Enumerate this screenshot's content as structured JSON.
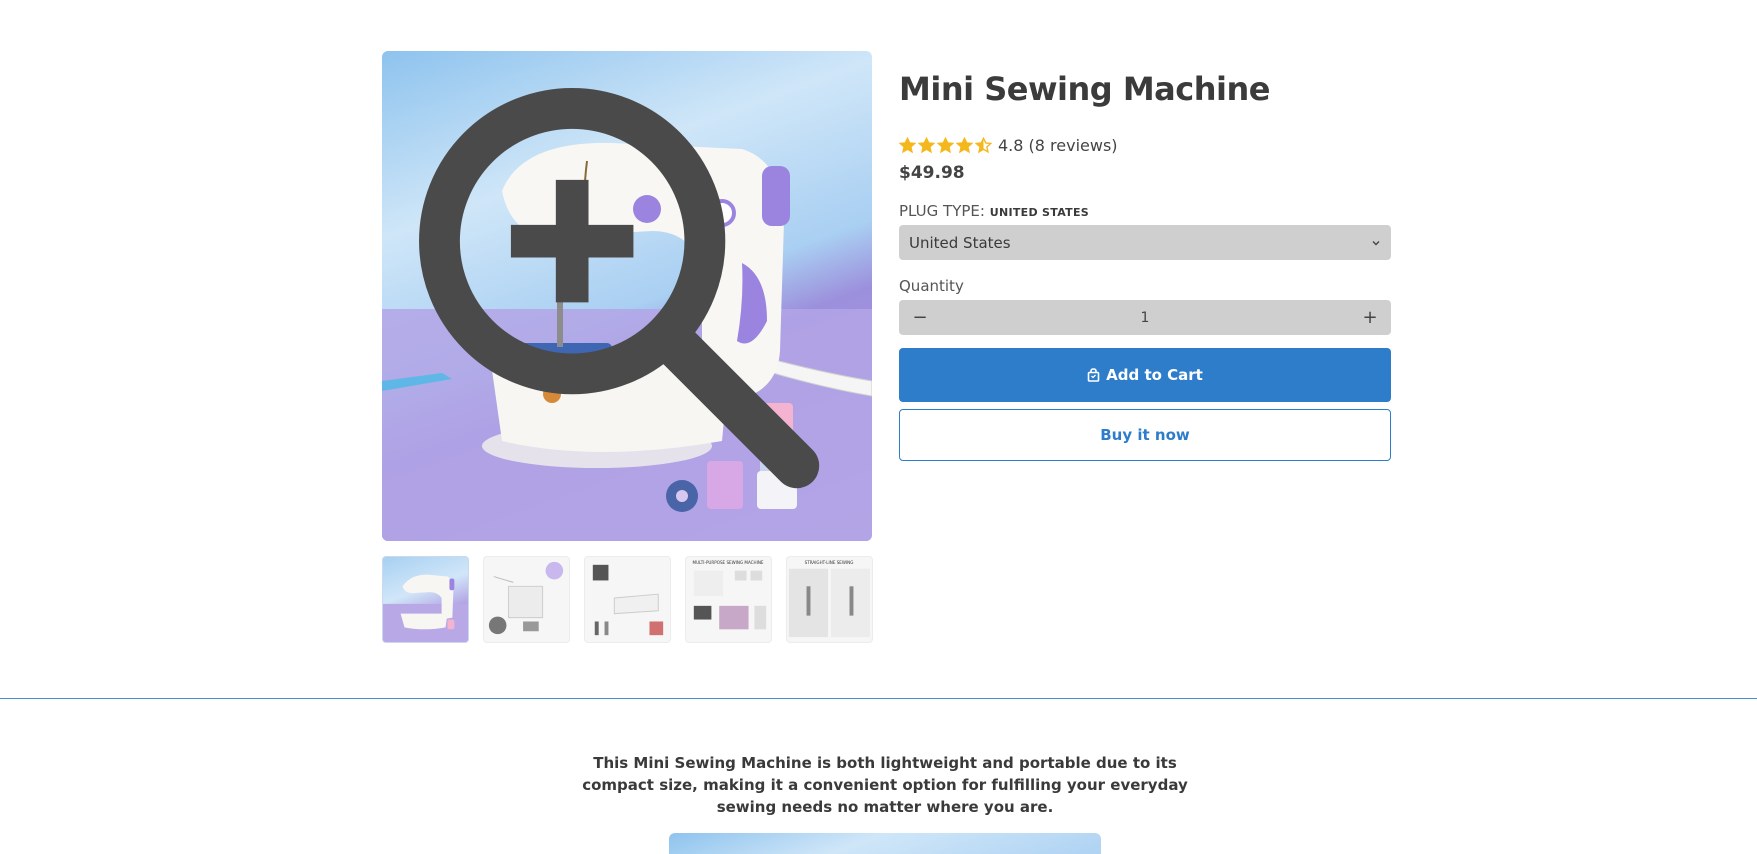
{
  "product": {
    "title": "Mini Sewing Machine",
    "rating_value": 4.5,
    "rating_text": "4.8 (8 reviews)",
    "price": "$49.98"
  },
  "option": {
    "label": "PLUG TYPE:",
    "selected_caption": "UNITED STATES",
    "selected_value": "United States"
  },
  "quantity": {
    "label": "Quantity",
    "value": "1",
    "minus": "−",
    "plus": "+"
  },
  "buttons": {
    "add_to_cart": "Add to Cart",
    "buy_now": "Buy it now"
  },
  "gallery": {
    "thumbnails": [
      {
        "caption": ""
      },
      {
        "caption": ""
      },
      {
        "caption": ""
      },
      {
        "caption": "MULTI-PURPOSE SEWING MACHINE"
      },
      {
        "caption": "STRAIGHT-LINE SEWING"
      }
    ]
  },
  "description": {
    "text": "This Mini Sewing Machine is both lightweight and portable due to its compact size, making it a convenient option for fulfilling your everyday sewing needs no matter where you are."
  },
  "icons": {
    "star": "star-icon",
    "zoom": "zoom-in-icon",
    "bag": "shopping-bag-icon",
    "chevron": "chevron-down-icon"
  },
  "colors": {
    "accent": "#2e7dcb",
    "star": "#f5b81c",
    "field_bg": "#cfcfcf",
    "text": "#3a3a3a"
  }
}
